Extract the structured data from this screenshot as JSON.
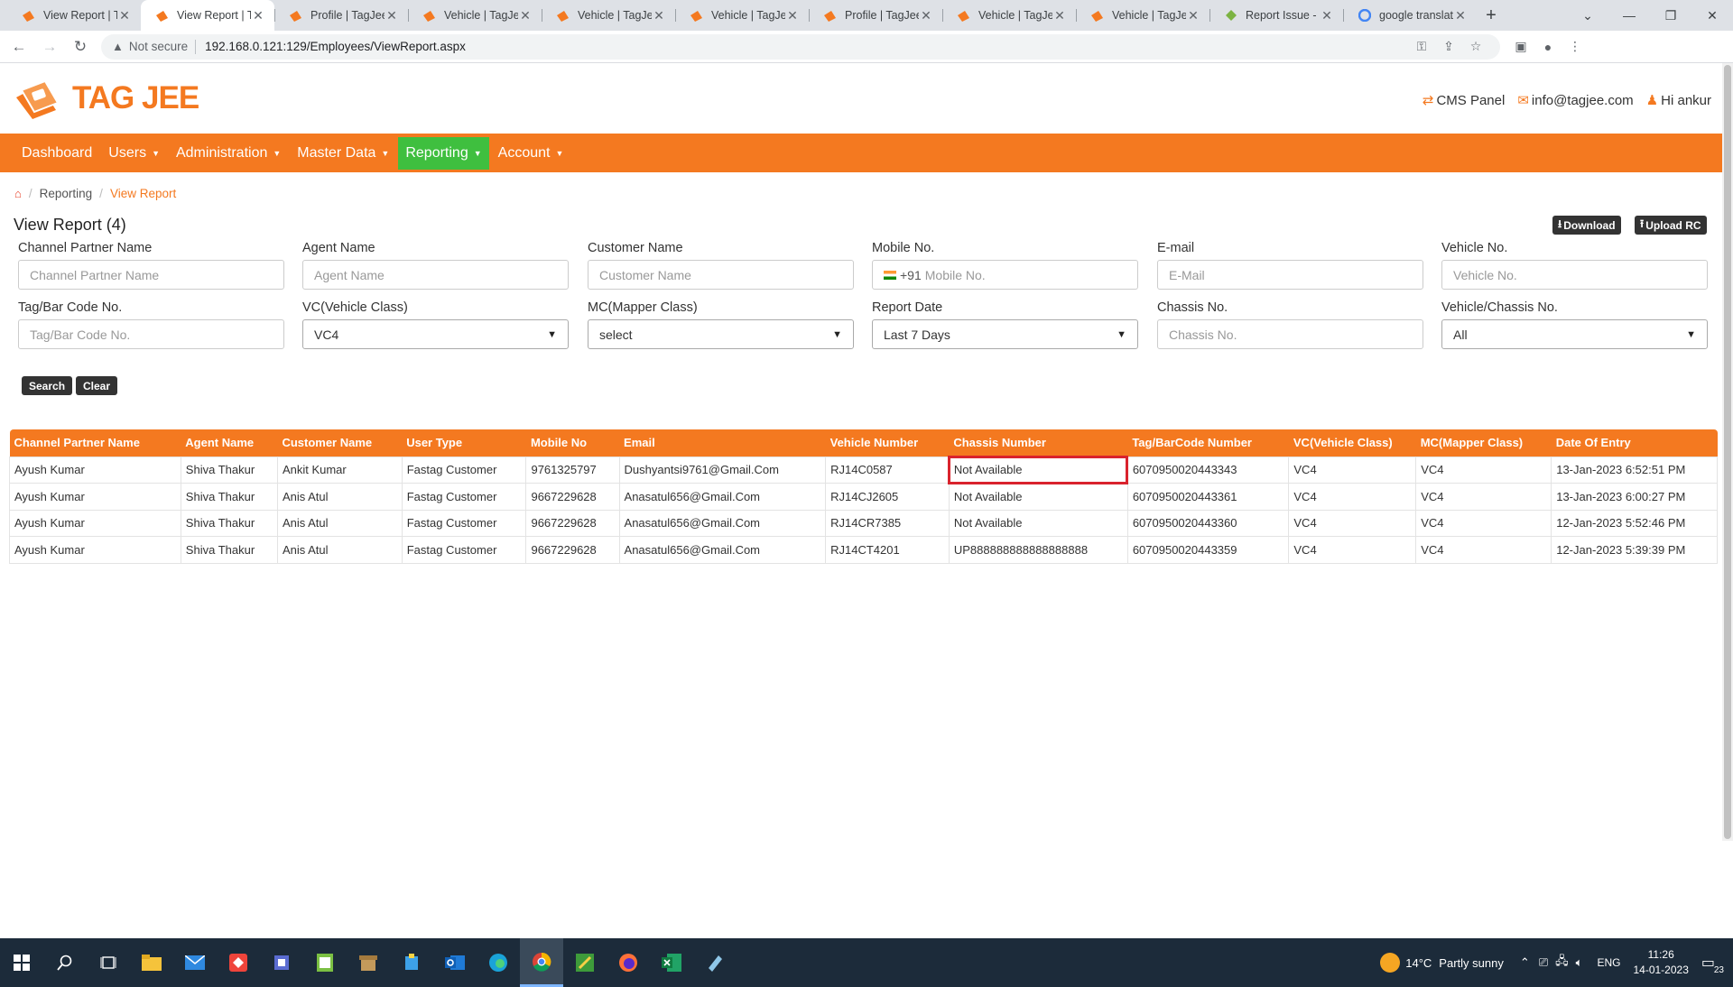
{
  "browser": {
    "tabs": [
      {
        "title": "View Report | Ta",
        "icon": "tagjee-favicon",
        "active": false
      },
      {
        "title": "View Report | Ta",
        "icon": "tagjee-favicon",
        "active": true
      },
      {
        "title": "Profile | TagJee",
        "icon": "tagjee-favicon",
        "active": false
      },
      {
        "title": "Vehicle | TagJee",
        "icon": "tagjee-favicon",
        "active": false
      },
      {
        "title": "Vehicle | TagJee",
        "icon": "tagjee-favicon",
        "active": false
      },
      {
        "title": "Vehicle | TagJee",
        "icon": "tagjee-favicon",
        "active": false
      },
      {
        "title": "Profile | TagJee",
        "icon": "tagjee-favicon",
        "active": false
      },
      {
        "title": "Vehicle | TagJee",
        "icon": "tagjee-favicon",
        "active": false
      },
      {
        "title": "Vehicle | TagJee",
        "icon": "tagjee-favicon",
        "active": false
      },
      {
        "title": "Report Issue - M",
        "icon": "report-favicon",
        "active": false
      },
      {
        "title": "google translate",
        "icon": "google-favicon",
        "active": false
      }
    ],
    "security_label": "Not secure",
    "url": "192.168.0.121:129/Employees/ViewReport.aspx"
  },
  "site": {
    "logo_text": "TAG JEE",
    "top_links": {
      "cms": "CMS Panel",
      "email": "info@tagjee.com",
      "greeting": "Hi ankur"
    },
    "nav": [
      {
        "label": "Dashboard",
        "caret": false,
        "active": false
      },
      {
        "label": "Users",
        "caret": true,
        "active": false
      },
      {
        "label": "Administration",
        "caret": true,
        "active": false
      },
      {
        "label": "Master Data",
        "caret": true,
        "active": false
      },
      {
        "label": "Reporting",
        "caret": true,
        "active": true
      },
      {
        "label": "Account",
        "caret": true,
        "active": false
      }
    ],
    "accent": "#f47920",
    "active_nav_color": "#3fbf3f"
  },
  "breadcrumb": {
    "parent": "Reporting",
    "current": "View Report"
  },
  "page": {
    "title": "View Report (4)",
    "download_label": "Download",
    "upload_label": "Upload RC"
  },
  "filters": {
    "channel_partner": {
      "label": "Channel Partner Name",
      "placeholder": "Channel Partner Name"
    },
    "agent": {
      "label": "Agent Name",
      "placeholder": "Agent Name"
    },
    "customer": {
      "label": "Customer Name",
      "placeholder": "Customer Name"
    },
    "mobile": {
      "label": "Mobile No.",
      "prefix": "+91",
      "placeholder": "Mobile No."
    },
    "email": {
      "label": "E-mail",
      "placeholder": "E-Mail"
    },
    "vehicle_no": {
      "label": "Vehicle No.",
      "placeholder": "Vehicle No."
    },
    "tag": {
      "label": "Tag/Bar Code No.",
      "placeholder": "Tag/Bar Code No."
    },
    "vc": {
      "label": "VC(Vehicle Class)",
      "value": "VC4"
    },
    "mc": {
      "label": "MC(Mapper Class)",
      "value": "select"
    },
    "report_date": {
      "label": "Report Date",
      "value": "Last 7 Days"
    },
    "chassis": {
      "label": "Chassis No.",
      "placeholder": "Chassis No."
    },
    "vehicle_chassis": {
      "label": "Vehicle/Chassis No.",
      "value": "All"
    },
    "search_label": "Search",
    "clear_label": "Clear"
  },
  "table": {
    "headers": [
      "Channel Partner Name",
      "Agent Name",
      "Customer Name",
      "User Type",
      "Mobile No",
      "Email",
      "Vehicle Number",
      "Chassis Number",
      "Tag/BarCode Number",
      "VC(Vehicle Class)",
      "MC(Mapper Class)",
      "Date Of Entry"
    ],
    "rows": [
      [
        "Ayush Kumar",
        "Shiva Thakur",
        "Ankit Kumar",
        "Fastag Customer",
        "9761325797",
        "Dushyantsi9761@Gmail.Com",
        "RJ14C0587",
        "Not Available",
        "6070950020443343",
        "VC4",
        "VC4",
        "13-Jan-2023 6:52:51 PM"
      ],
      [
        "Ayush Kumar",
        "Shiva Thakur",
        "Anis Atul",
        "Fastag Customer",
        "9667229628",
        "Anasatul656@Gmail.Com",
        "RJ14CJ2605",
        "Not Available",
        "6070950020443361",
        "VC4",
        "VC4",
        "13-Jan-2023 6:00:27 PM"
      ],
      [
        "Ayush Kumar",
        "Shiva Thakur",
        "Anis Atul",
        "Fastag Customer",
        "9667229628",
        "Anasatul656@Gmail.Com",
        "RJ14CR7385",
        "Not Available",
        "6070950020443360",
        "VC4",
        "VC4",
        "12-Jan-2023 5:52:46 PM"
      ],
      [
        "Ayush Kumar",
        "Shiva Thakur",
        "Anis Atul",
        "Fastag Customer",
        "9667229628",
        "Anasatul656@Gmail.Com",
        "RJ14CT4201",
        "UP888888888888888888",
        "6070950020443359",
        "VC4",
        "VC4",
        "12-Jan-2023 5:39:39 PM"
      ]
    ],
    "highlight_color": "#d9232d"
  },
  "taskbar": {
    "weather_temp": "14°C",
    "weather_text": "Partly sunny",
    "language": "ENG",
    "time": "11:26",
    "date": "14-01-2023",
    "notifications": "23"
  }
}
